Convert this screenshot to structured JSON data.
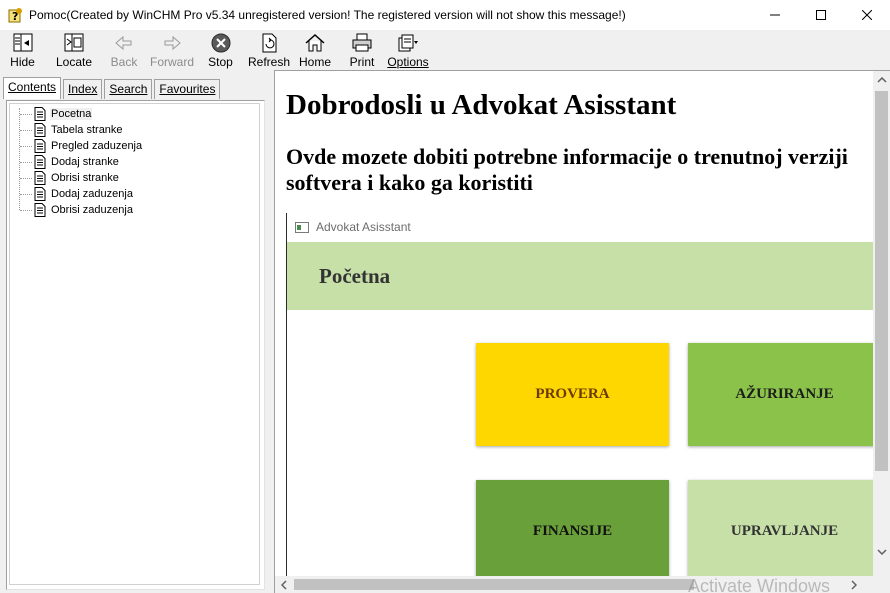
{
  "window": {
    "title": "Pomoc(Created by WinCHM Pro v5.34 unregistered version! The registered version will not show this message!)"
  },
  "toolbar": {
    "buttons": [
      {
        "label": "Hide",
        "icon": "hide-icon",
        "enabled": true
      },
      {
        "label": "Locate",
        "icon": "locate-icon",
        "enabled": true
      },
      {
        "label": "Back",
        "icon": "back-arrow-icon",
        "enabled": false
      },
      {
        "label": "Forward",
        "icon": "forward-arrow-icon",
        "enabled": false
      },
      {
        "label": "Stop",
        "icon": "stop-icon",
        "enabled": true
      },
      {
        "label": "Refresh",
        "icon": "refresh-icon",
        "enabled": true
      },
      {
        "label": "Home",
        "icon": "home-icon",
        "enabled": true
      },
      {
        "label": "Print",
        "icon": "print-icon",
        "enabled": true
      },
      {
        "label": "Options",
        "icon": "options-icon",
        "enabled": true
      }
    ]
  },
  "nav": {
    "tabs": [
      {
        "label": "Contents",
        "active": true
      },
      {
        "label": "Index",
        "active": false
      },
      {
        "label": "Search",
        "active": false
      },
      {
        "label": "Favourites",
        "active": false
      }
    ],
    "tree": [
      {
        "label": "Pocetna",
        "selected": true
      },
      {
        "label": "Tabela stranke",
        "selected": false
      },
      {
        "label": "Pregled zaduzenja",
        "selected": false
      },
      {
        "label": "Dodaj stranke",
        "selected": false
      },
      {
        "label": "Obrisi stranke",
        "selected": false
      },
      {
        "label": "Dodaj zaduzenja",
        "selected": false
      },
      {
        "label": "Obrisi zaduzenja",
        "selected": false
      }
    ]
  },
  "content": {
    "heading": "Dobrodosli u Advokat Asisstant",
    "subheading": "Ovde mozete dobiti potrebne informacije o trenutnoj verziji softvera i kako ga koristiti",
    "screenshot": {
      "window_title": "Advokat Asisstant",
      "page_header": "Početna",
      "header_color": "#c6e0a8",
      "tiles": [
        {
          "label": "PROVERA",
          "color": "#ffd700"
        },
        {
          "label": "AŽURIRANJE",
          "color": "#8bc34a"
        },
        {
          "label": "FINANSIJE",
          "color": "#6aa03a"
        },
        {
          "label": "UPRAVLJANJE",
          "color": "#c6e0a8"
        }
      ]
    }
  },
  "watermark": "Activate Windows"
}
